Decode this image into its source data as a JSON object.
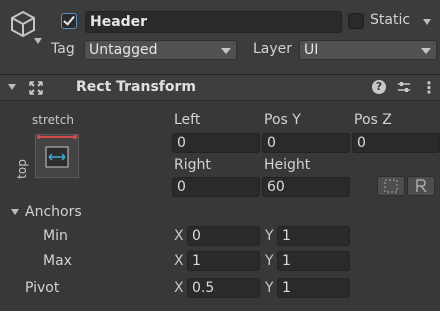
{
  "header": {
    "active": true,
    "name": "Header",
    "static_label": "Static",
    "static_checked": false,
    "tag_label": "Tag",
    "tag_value": "Untagged",
    "layer_label": "Layer",
    "layer_value": "UI"
  },
  "component": {
    "title": "Rect Transform",
    "help_icon_glyph": "?",
    "menu_icon_glyph": "⋮",
    "anchor_preset_top": "stretch",
    "anchor_preset_side": "top"
  },
  "fields": {
    "left_label": "Left",
    "left_value": "0",
    "posy_label": "Pos Y",
    "posy_value": "0",
    "posz_label": "Pos Z",
    "posz_value": "0",
    "right_label": "Right",
    "right_value": "0",
    "height_label": "Height",
    "height_value": "60"
  },
  "anchors": {
    "label": "Anchors",
    "min_label": "Min",
    "min_x": "0",
    "min_y": "1",
    "max_label": "Max",
    "max_x": "1",
    "max_y": "1",
    "x_axis": "X",
    "y_axis": "Y"
  },
  "pivot": {
    "label": "Pivot",
    "x": "0.5",
    "y": "1"
  },
  "colors": {
    "panel_bg": "#383838",
    "header_bg": "#3e3e3e",
    "field_bg": "#2a2a2a",
    "accent": "#5c8fc7"
  },
  "icons": {
    "gameobject": "cube-icon",
    "rect_transform": "rect-transform-icon",
    "help": "help-icon",
    "presets": "sliders-icon",
    "menu": "kebab-menu-icon",
    "blueprint": "blueprint-mode-icon",
    "raw": "raw-edit-icon"
  }
}
